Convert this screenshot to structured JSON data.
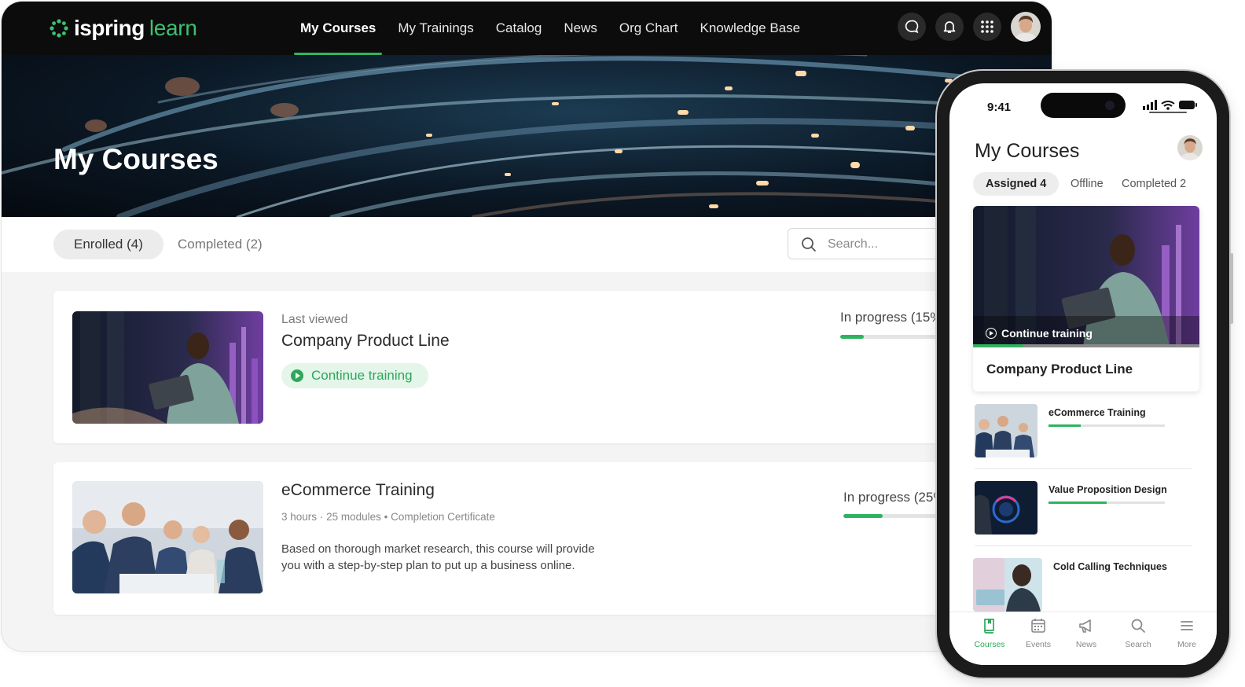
{
  "app": {
    "brand": "ispring",
    "product": "learn"
  },
  "nav": {
    "items": [
      {
        "label": "My Courses",
        "active": true
      },
      {
        "label": "My Trainings",
        "active": false
      },
      {
        "label": "Catalog",
        "active": false
      },
      {
        "label": "News",
        "active": false
      },
      {
        "label": "Org Chart",
        "active": false
      },
      {
        "label": "Knowledge Base",
        "active": false
      }
    ],
    "icons": [
      "chat-icon",
      "bell-icon",
      "apps-grid-icon"
    ]
  },
  "hero": {
    "title": "My Courses"
  },
  "filters": {
    "enrolled": "Enrolled (4)",
    "completed": "Completed (2)"
  },
  "search": {
    "placeholder": "Search..."
  },
  "courses": [
    {
      "meta": "Last viewed",
      "title": "Company Product Line",
      "action": "Continue training",
      "progress_label": "In progress (15%)",
      "progress": 0.15
    },
    {
      "title": "eCommerce Training",
      "duration": "3 hours",
      "modules": "25 modules",
      "certificate": "Completion Certificate",
      "description": "Based on thorough market research, this course will provide you with a step-by-step plan to put up a business online.",
      "progress_label": "In progress (25%)",
      "progress": 0.25
    }
  ],
  "phone": {
    "time": "9:41",
    "title": "My Courses",
    "tabs": [
      {
        "label": "Assigned 4",
        "active": true
      },
      {
        "label": "Offline",
        "active": false
      },
      {
        "label": "Completed 2",
        "active": false
      }
    ],
    "featured": {
      "action": "Continue training",
      "title": "Company Product Line",
      "progress": 0.22
    },
    "list": [
      {
        "title": "eCommerce Training",
        "progress": 0.28
      },
      {
        "title": "Value Proposition Design",
        "progress": 0.5
      },
      {
        "title": "Cold Calling Techniques",
        "progress": 0
      }
    ],
    "tabbar": [
      {
        "label": "Courses",
        "icon": "book-icon",
        "active": true
      },
      {
        "label": "Events",
        "icon": "calendar-icon",
        "active": false
      },
      {
        "label": "News",
        "icon": "megaphone-icon",
        "active": false
      },
      {
        "label": "Search",
        "icon": "search-icon",
        "active": false
      },
      {
        "label": "More",
        "icon": "menu-icon",
        "active": false
      }
    ]
  },
  "colors": {
    "accent": "#2fb360",
    "topbar": "#0c0c0c",
    "page_bg": "#f4f4f4"
  }
}
